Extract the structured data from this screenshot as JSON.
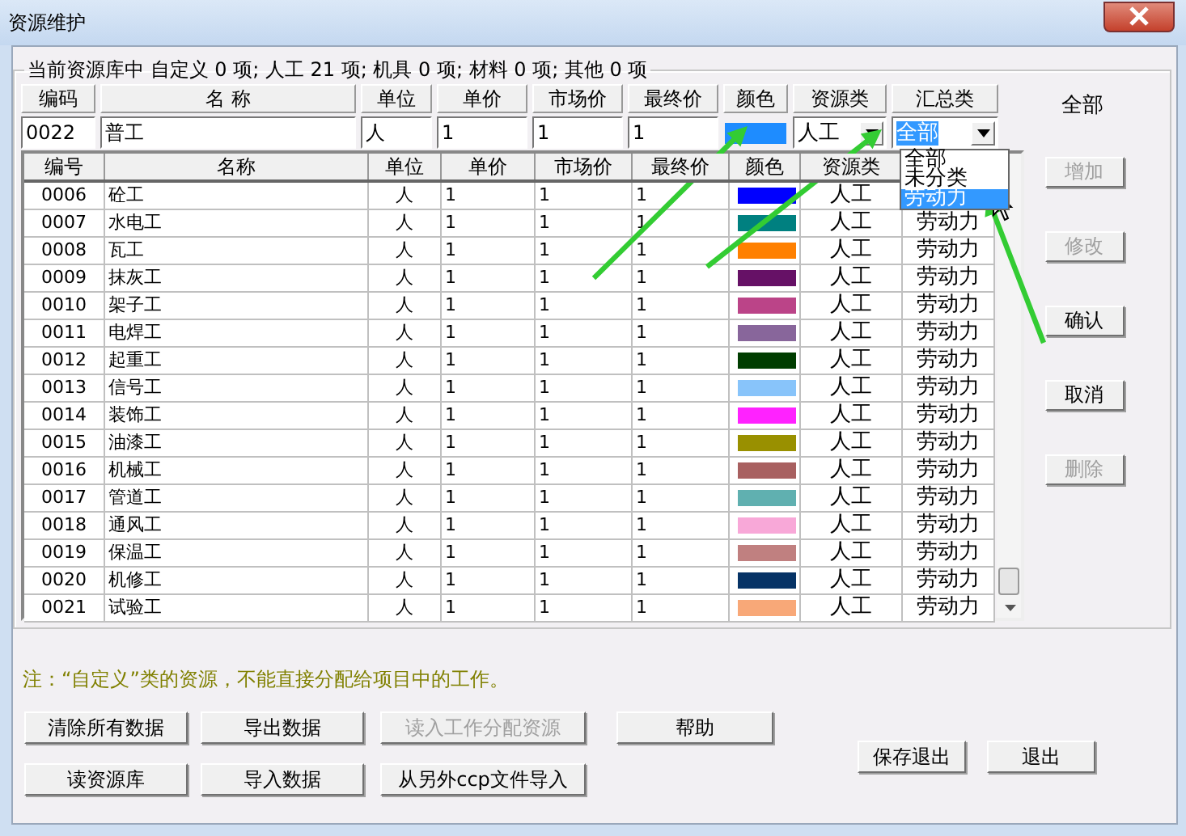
{
  "window": {
    "title": "资源维护"
  },
  "summary": "当前资源库中 自定义 0 项; 人工 21 项; 机具 0 项; 材料 0 项; 其他 0 项",
  "edit_row": {
    "headers": [
      "编码",
      "名 称",
      "单位",
      "单价",
      "市场价",
      "最终价",
      "颜色",
      "资源类",
      "汇总类"
    ],
    "code": "0022",
    "name": "普工",
    "unit": "人",
    "price": "1",
    "market_price": "1",
    "final_price": "1",
    "color": "#1e8cff",
    "resource_class": "人工",
    "summary_class": "全部"
  },
  "summary_dropdown": {
    "expanded": true,
    "options": [
      {
        "label": "全部",
        "selected": false
      },
      {
        "label": "未分类",
        "selected": false
      },
      {
        "label": "劳动力",
        "selected": true
      }
    ]
  },
  "filter_label": "全部",
  "side_buttons": [
    {
      "label": "增加",
      "disabled": true
    },
    {
      "label": "修改",
      "disabled": true
    },
    {
      "label": "确认",
      "disabled": false
    },
    {
      "label": "取消",
      "disabled": false
    },
    {
      "label": "删除",
      "disabled": true
    }
  ],
  "table": {
    "columns": [
      "编号",
      "名称",
      "单位",
      "单价",
      "市场价",
      "最终价",
      "颜色",
      "资源类"
    ],
    "rows": [
      {
        "code": "0006",
        "name": "砼工",
        "unit": "人",
        "price": "1",
        "market_price": "1",
        "final_price": "1",
        "color": "#0000ff",
        "resource_class": "人工"
      },
      {
        "code": "0007",
        "name": "水电工",
        "unit": "人",
        "price": "1",
        "market_price": "1",
        "final_price": "1",
        "color": "#008080",
        "resource_class": "人工",
        "summary_class": "劳动力"
      },
      {
        "code": "0008",
        "name": "瓦工",
        "unit": "人",
        "price": "1",
        "market_price": "1",
        "final_price": "1",
        "color": "#ff8000",
        "resource_class": "人工",
        "summary_class": "劳动力"
      },
      {
        "code": "0009",
        "name": "抹灰工",
        "unit": "人",
        "price": "1",
        "market_price": "1",
        "final_price": "1",
        "color": "#661166",
        "resource_class": "人工",
        "summary_class": "劳动力"
      },
      {
        "code": "0010",
        "name": "架子工",
        "unit": "人",
        "price": "1",
        "market_price": "1",
        "final_price": "1",
        "color": "#bb4488",
        "resource_class": "人工",
        "summary_class": "劳动力"
      },
      {
        "code": "0011",
        "name": "电焊工",
        "unit": "人",
        "price": "1",
        "market_price": "1",
        "final_price": "1",
        "color": "#88669b",
        "resource_class": "人工",
        "summary_class": "劳动力"
      },
      {
        "code": "0012",
        "name": "起重工",
        "unit": "人",
        "price": "1",
        "market_price": "1",
        "final_price": "1",
        "color": "#003d00",
        "resource_class": "人工",
        "summary_class": "劳动力"
      },
      {
        "code": "0013",
        "name": "信号工",
        "unit": "人",
        "price": "1",
        "market_price": "1",
        "final_price": "1",
        "color": "#88c4fa",
        "resource_class": "人工",
        "summary_class": "劳动力"
      },
      {
        "code": "0014",
        "name": "装饰工",
        "unit": "人",
        "price": "1",
        "market_price": "1",
        "final_price": "1",
        "color": "#ff22ff",
        "resource_class": "人工",
        "summary_class": "劳动力"
      },
      {
        "code": "0015",
        "name": "油漆工",
        "unit": "人",
        "price": "1",
        "market_price": "1",
        "final_price": "1",
        "color": "#999000",
        "resource_class": "人工",
        "summary_class": "劳动力"
      },
      {
        "code": "0016",
        "name": "机械工",
        "unit": "人",
        "price": "1",
        "market_price": "1",
        "final_price": "1",
        "color": "#a86060",
        "resource_class": "人工",
        "summary_class": "劳动力"
      },
      {
        "code": "0017",
        "name": "管道工",
        "unit": "人",
        "price": "1",
        "market_price": "1",
        "final_price": "1",
        "color": "#60b0b0",
        "resource_class": "人工",
        "summary_class": "劳动力"
      },
      {
        "code": "0018",
        "name": "通风工",
        "unit": "人",
        "price": "1",
        "market_price": "1",
        "final_price": "1",
        "color": "#f8a8d8",
        "resource_class": "人工",
        "summary_class": "劳动力"
      },
      {
        "code": "0019",
        "name": "保温工",
        "unit": "人",
        "price": "1",
        "market_price": "1",
        "final_price": "1",
        "color": "#c08080",
        "resource_class": "人工",
        "summary_class": "劳动力"
      },
      {
        "code": "0020",
        "name": "机修工",
        "unit": "人",
        "price": "1",
        "market_price": "1",
        "final_price": "1",
        "color": "#063366",
        "resource_class": "人工",
        "summary_class": "劳动力"
      },
      {
        "code": "0021",
        "name": "试验工",
        "unit": "人",
        "price": "1",
        "market_price": "1",
        "final_price": "1",
        "color": "#f8a878",
        "resource_class": "人工",
        "summary_class": "劳动力"
      }
    ]
  },
  "note": "注：“自定义”类的资源，不能直接分配给项目中的工作。",
  "bottom_buttons": [
    {
      "label": "清除所有数据",
      "disabled": false
    },
    {
      "label": "导出数据",
      "disabled": false
    },
    {
      "label": "读入工作分配资源",
      "disabled": true
    },
    {
      "label": "帮助",
      "disabled": false
    },
    {
      "label": "读资源库",
      "disabled": false
    },
    {
      "label": "导入数据",
      "disabled": false
    },
    {
      "label": "从另外ccp文件导入",
      "disabled": false
    }
  ],
  "exit_buttons": [
    {
      "label": "保存退出",
      "disabled": false
    },
    {
      "label": "退出",
      "disabled": false
    }
  ]
}
